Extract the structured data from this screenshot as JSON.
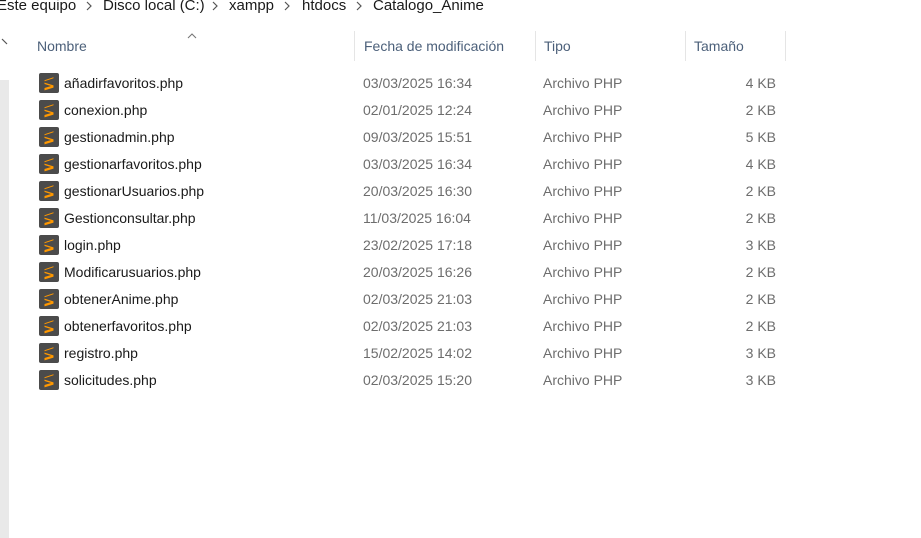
{
  "breadcrumb": [
    "Este equipo",
    "Disco local (C:)",
    "xampp",
    "htdocs",
    "Catalogo_Anime"
  ],
  "columns": {
    "name": "Nombre",
    "date": "Fecha de modificación",
    "type": "Tipo",
    "size": "Tamaño"
  },
  "sort": {
    "column": "name",
    "direction": "ascending"
  },
  "colors": {
    "sublime_icon_bg": "#4b4b4b",
    "sublime_icon_fg": "#ff9800",
    "header_text": "#4c607a",
    "meta_text": "#6d6d6d"
  },
  "files": [
    {
      "name": "añadirfavoritos.php",
      "date": "03/03/2025 16:34",
      "type": "Archivo PHP",
      "size": "4 KB",
      "icon": "sublime-text-file-icon"
    },
    {
      "name": "conexion.php",
      "date": "02/01/2025 12:24",
      "type": "Archivo PHP",
      "size": "2 KB",
      "icon": "sublime-text-file-icon"
    },
    {
      "name": "gestionadmin.php",
      "date": "09/03/2025 15:51",
      "type": "Archivo PHP",
      "size": "5 KB",
      "icon": "sublime-text-file-icon"
    },
    {
      "name": "gestionarfavoritos.php",
      "date": "03/03/2025 16:34",
      "type": "Archivo PHP",
      "size": "4 KB",
      "icon": "sublime-text-file-icon"
    },
    {
      "name": "gestionarUsuarios.php",
      "date": "20/03/2025 16:30",
      "type": "Archivo PHP",
      "size": "2 KB",
      "icon": "sublime-text-file-icon"
    },
    {
      "name": "Gestionconsultar.php",
      "date": "11/03/2025 16:04",
      "type": "Archivo PHP",
      "size": "2 KB",
      "icon": "sublime-text-file-icon"
    },
    {
      "name": "login.php",
      "date": "23/02/2025 17:18",
      "type": "Archivo PHP",
      "size": "3 KB",
      "icon": "sublime-text-file-icon"
    },
    {
      "name": "Modificarusuarios.php",
      "date": "20/03/2025 16:26",
      "type": "Archivo PHP",
      "size": "2 KB",
      "icon": "sublime-text-file-icon"
    },
    {
      "name": "obtenerAnime.php",
      "date": "02/03/2025 21:03",
      "type": "Archivo PHP",
      "size": "2 KB",
      "icon": "sublime-text-file-icon"
    },
    {
      "name": "obtenerfavoritos.php",
      "date": "02/03/2025 21:03",
      "type": "Archivo PHP",
      "size": "2 KB",
      "icon": "sublime-text-file-icon"
    },
    {
      "name": "registro.php",
      "date": "15/02/2025 14:02",
      "type": "Archivo PHP",
      "size": "3 KB",
      "icon": "sublime-text-file-icon"
    },
    {
      "name": "solicitudes.php",
      "date": "02/03/2025 15:20",
      "type": "Archivo PHP",
      "size": "3 KB",
      "icon": "sublime-text-file-icon"
    }
  ]
}
